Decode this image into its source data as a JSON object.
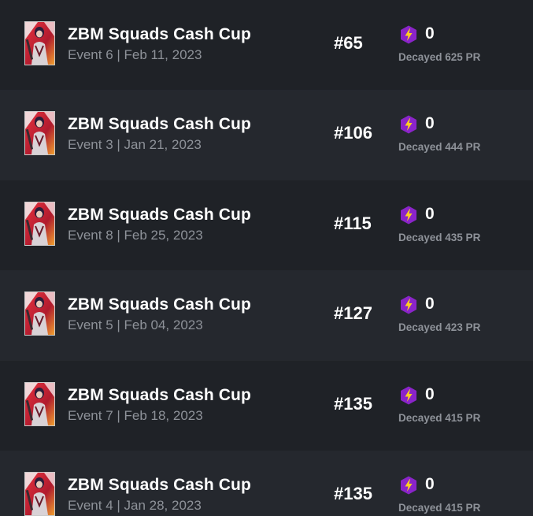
{
  "theme": {
    "row_dark": "#1f2227",
    "row_light": "#25282e",
    "accent_purple": "#8a24c9",
    "bolt_yellow": "#ffd21f"
  },
  "icons": {
    "thumbnail": "event-thumbnail-image",
    "power_rank": "lightning-hexagon-icon"
  },
  "events": [
    {
      "title": "ZBM Squads Cash Cup",
      "subtitle": "Event 6 | Feb 11, 2023",
      "rank": "#65",
      "pr": "0",
      "decay": "Decayed 625 PR"
    },
    {
      "title": "ZBM Squads Cash Cup",
      "subtitle": "Event 3 | Jan 21, 2023",
      "rank": "#106",
      "pr": "0",
      "decay": "Decayed 444 PR"
    },
    {
      "title": "ZBM Squads Cash Cup",
      "subtitle": "Event 8 | Feb 25, 2023",
      "rank": "#115",
      "pr": "0",
      "decay": "Decayed 435 PR"
    },
    {
      "title": "ZBM Squads Cash Cup",
      "subtitle": "Event 5 | Feb 04, 2023",
      "rank": "#127",
      "pr": "0",
      "decay": "Decayed 423 PR"
    },
    {
      "title": "ZBM Squads Cash Cup",
      "subtitle": "Event 7 | Feb 18, 2023",
      "rank": "#135",
      "pr": "0",
      "decay": "Decayed 415 PR"
    },
    {
      "title": "ZBM Squads Cash Cup",
      "subtitle": "Event 4 | Jan 28, 2023",
      "rank": "#135",
      "pr": "0",
      "decay": "Decayed 415 PR"
    }
  ]
}
